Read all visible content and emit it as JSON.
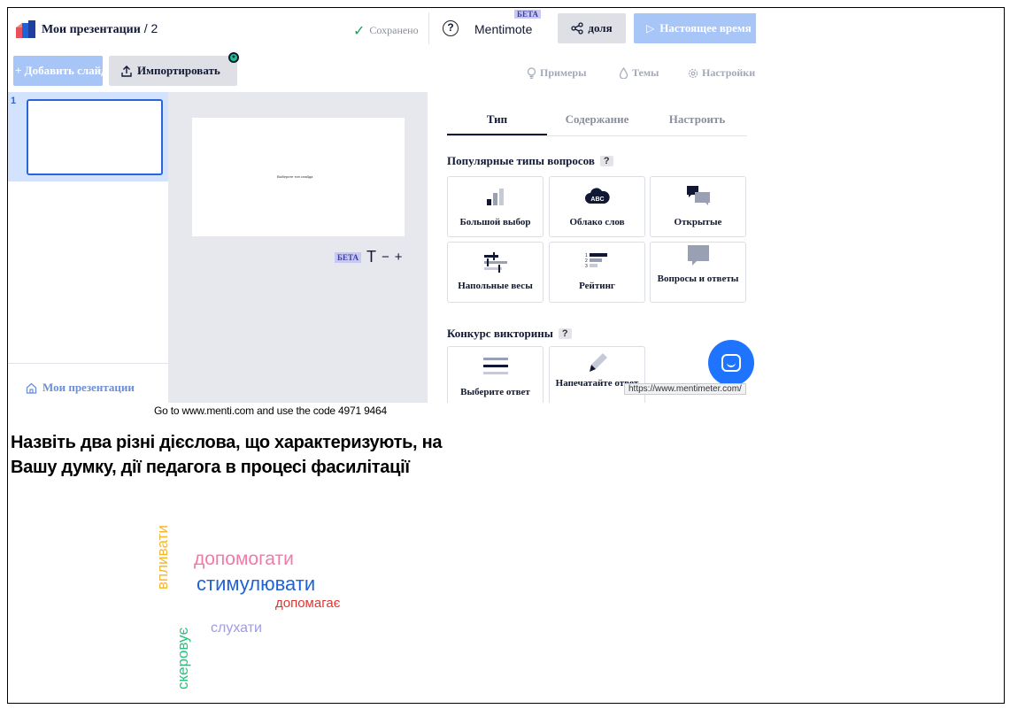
{
  "header": {
    "title": "Мои презентации",
    "slash": " / 2",
    "saved": "Сохранено",
    "mentimote": "Mentimote",
    "beta": "БЕТА",
    "share": "доля",
    "live": "Настоящее время"
  },
  "toolbar": {
    "add_slide": "+ Добавить слайд",
    "import": "Импортировать",
    "examples": "Примеры",
    "themes": "Темы",
    "settings": "Настройки"
  },
  "slides": {
    "number": "1"
  },
  "left": {
    "my_presentations": "Мои презентации"
  },
  "canvas": {
    "slide_text": "Выберите тип слайда",
    "beta": "БЕТА",
    "text_icon": "T",
    "zoom_minus": "−",
    "zoom_plus": "+"
  },
  "panel": {
    "tabs": [
      "Тип",
      "Содержание",
      "Настроить"
    ],
    "popular_heading": "Популярные типы вопросов",
    "help": "?",
    "popular": [
      {
        "label": "Большой выбор",
        "icon": "bar-chart-icon"
      },
      {
        "label": "Облако слов",
        "icon": "word-cloud-icon"
      },
      {
        "label": "Открытые",
        "icon": "speech-bubbles-icon"
      },
      {
        "label": "Напольные весы",
        "icon": "scales-icon"
      },
      {
        "label": "Рейтинг",
        "icon": "ranking-icon"
      },
      {
        "label": "Вопросы и ответы",
        "icon": "qa-bubble-icon"
      }
    ],
    "quiz_heading": "Конкурс викторины",
    "quiz": [
      {
        "label": "Выберите ответ",
        "icon": "lines-icon"
      },
      {
        "label": "Напечатайте ответ",
        "icon": "pen-icon"
      }
    ],
    "cloud_icon_text": "ABC"
  },
  "status_url": "https://www.mentimeter.com/",
  "presentation": {
    "code_line": "Go to www.menti.com and use the code 4971 9464",
    "question": "Назвіть два різні дієслова, що характеризують, на Вашу думку, дії педагога в процесі фасилітації",
    "words": [
      {
        "text": "впливати",
        "color": "#f5b731",
        "size": 17,
        "vertical": true
      },
      {
        "text": "допомогати",
        "color": "#f27aa8",
        "size": 21,
        "vertical": false
      },
      {
        "text": "стимулювати",
        "color": "#1f62d6",
        "size": 22,
        "vertical": false
      },
      {
        "text": "допомагає",
        "color": "#e0352f",
        "size": 15,
        "vertical": false
      },
      {
        "text": "слухати",
        "color": "#9f9be4",
        "size": 16,
        "vertical": false
      },
      {
        "text": "скеровує",
        "color": "#22c57d",
        "size": 17,
        "vertical": true
      }
    ]
  },
  "colors": {
    "accent": "#2b66d9",
    "button_light_blue": "#a8c5f8",
    "intercom": "#1f74ff"
  }
}
